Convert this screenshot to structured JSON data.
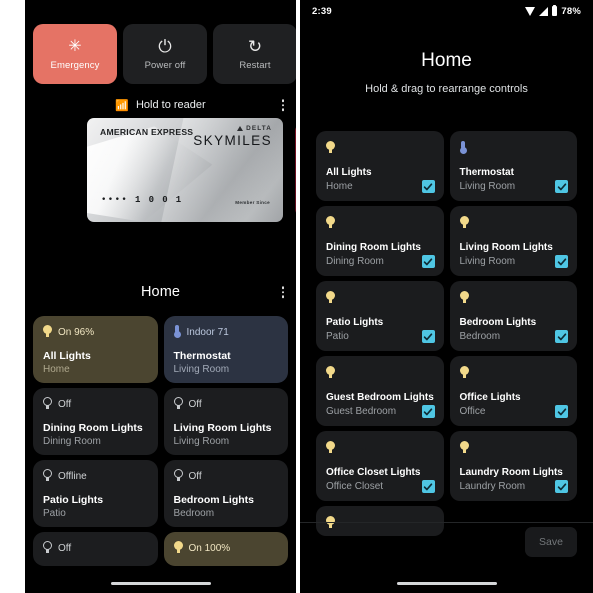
{
  "left_phone": {
    "power_menu": {
      "buttons": [
        {
          "label": "Emergency",
          "icon": "emergency-asterisk-icon",
          "glyph": "✳",
          "accent": "#e57365"
        },
        {
          "label": "Power off",
          "icon": "power-icon",
          "glyph": "⏻",
          "accent": "#1f2022"
        },
        {
          "label": "Restart",
          "icon": "restart-icon",
          "glyph": "↻",
          "accent": "#1f2022"
        }
      ]
    },
    "reader": {
      "label": "Hold to reader",
      "icon": "nfc-wireless-icon",
      "glyph": "\u0004",
      "overflow_icon": "more-vertical-icon"
    },
    "wallet_card": {
      "brand": "AMERICAN EXPRESS",
      "partner": "DELTA",
      "program": "SKYMILES",
      "masked_number": "•••• 1 0 0 1",
      "member_since": "Member Since",
      "next_card_masked": "•••"
    },
    "home": {
      "title": "Home",
      "overflow_icon": "more-vertical-icon",
      "tiles": [
        {
          "status": "On 96%",
          "name": "All Lights",
          "room": "Home",
          "icon": "bulb-on-icon",
          "state": "on-yellow"
        },
        {
          "status": "Indoor 71",
          "name": "Thermostat",
          "room": "Living Room",
          "icon": "thermostat-icon",
          "state": "on-blue"
        },
        {
          "status": "Off",
          "name": "Dining Room Lights",
          "room": "Dining Room",
          "icon": "bulb-off-icon",
          "state": "off"
        },
        {
          "status": "Off",
          "name": "Living Room Lights",
          "room": "Living Room",
          "icon": "bulb-off-icon",
          "state": "off"
        },
        {
          "status": "Offline",
          "name": "Patio Lights",
          "room": "Patio",
          "icon": "bulb-off-icon",
          "state": "off"
        },
        {
          "status": "Off",
          "name": "Bedroom Lights",
          "room": "Bedroom",
          "icon": "bulb-off-icon",
          "state": "off"
        },
        {
          "status": "Off",
          "name": "",
          "room": "",
          "icon": "bulb-off-icon",
          "state": "off"
        },
        {
          "status": "On 100%",
          "name": "",
          "room": "",
          "icon": "bulb-on-icon",
          "state": "on-yellow"
        }
      ]
    }
  },
  "right_phone": {
    "status_bar": {
      "time": "2:39",
      "battery_percent": "78%",
      "icons": [
        "wifi-icon",
        "signal-icon",
        "battery-icon"
      ]
    },
    "title": "Home",
    "subtitle": "Hold & drag to rearrange controls",
    "tiles": [
      {
        "name": "All Lights",
        "room": "Home",
        "icon": "bulb-on-icon",
        "checked": true
      },
      {
        "name": "Thermostat",
        "room": "Living Room",
        "icon": "thermostat-icon",
        "checked": true
      },
      {
        "name": "Dining Room Lights",
        "room": "Dining Room",
        "icon": "bulb-on-icon",
        "checked": true
      },
      {
        "name": "Living Room Lights",
        "room": "Living Room",
        "icon": "bulb-on-icon",
        "checked": true
      },
      {
        "name": "Patio Lights",
        "room": "Patio",
        "icon": "bulb-on-icon",
        "checked": true
      },
      {
        "name": "Bedroom Lights",
        "room": "Bedroom",
        "icon": "bulb-on-icon",
        "checked": true
      },
      {
        "name": "Guest Bedroom Lights",
        "room": "Guest Bedroom",
        "icon": "bulb-on-icon",
        "checked": true
      },
      {
        "name": "Office Lights",
        "room": "Office",
        "icon": "bulb-on-icon",
        "checked": true
      },
      {
        "name": "Office Closet Lights",
        "room": "Office Closet",
        "icon": "bulb-on-icon",
        "checked": true
      },
      {
        "name": "Laundry Room Lights",
        "room": "Laundry Room",
        "icon": "bulb-on-icon",
        "checked": true
      },
      {
        "name": "",
        "room": "",
        "icon": "bulb-on-icon",
        "checked": false
      }
    ],
    "save_label": "Save"
  },
  "colors": {
    "emergency": "#e57365",
    "checkbox": "#4fc6e4",
    "tile_on_yellow": "#4b4530",
    "tile_on_blue": "#2c3342",
    "tile_off": "#1c1d1f",
    "background": "#000000"
  }
}
